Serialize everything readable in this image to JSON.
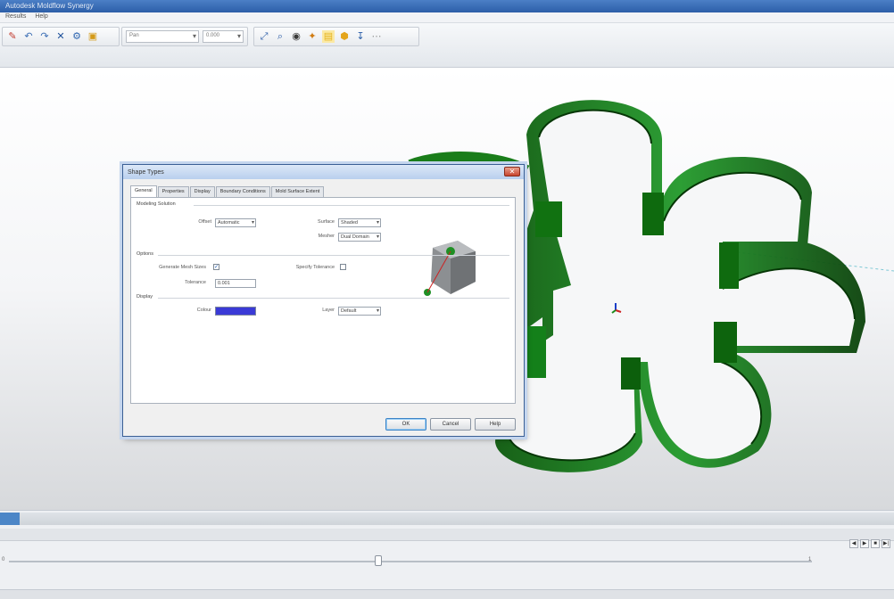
{
  "window": {
    "title": "Autodesk Moldflow Synergy"
  },
  "menu": {
    "items": [
      "Results",
      "Help"
    ]
  },
  "toolbar": {
    "combo1": "Pan",
    "combo2": "0.000",
    "icons": [
      "new-icon",
      "undo-icon",
      "redo-icon",
      "delete-icon",
      "settings-icon",
      "save-icon",
      "rotate-icon",
      "zoom-icon",
      "lock-icon",
      "select-icon",
      "highlight-icon",
      "pin-icon",
      "pointer-icon"
    ]
  },
  "dialog": {
    "title": "Shape Types",
    "tabs": [
      "General",
      "Properties",
      "Display",
      "Boundary Conditions",
      "Mold Surface Extent"
    ],
    "active_tab": 0,
    "sections": {
      "general": "Modeling Solution",
      "options": "Options",
      "display": "Display"
    },
    "fields": {
      "offset_label": "Offset",
      "offset_value": "Automatic",
      "surface_label": "Surface",
      "surface_value": "Shaded",
      "mesher_label": "Mesher",
      "mesher_value": "Dual Domain",
      "auto_sizes_label": "Generate Mesh Sizes",
      "auto_sizes_checked": true,
      "tolerance_label": "Tolerance",
      "tolerance_value": "0.001",
      "specify_label": "Specify Tolerance",
      "specify_checked": false,
      "color_label": "Colour",
      "color_value": "#3a3ad6",
      "layer_label": "Layer",
      "layer_value": "Default"
    },
    "buttons": {
      "ok": "OK",
      "cancel": "Cancel",
      "help": "Help"
    }
  },
  "timeline": {
    "left_label": "0",
    "right_label": "1",
    "controls": [
      "◀",
      "▶",
      "■",
      "▶|"
    ]
  },
  "colors": {
    "part_green": "#1f8a1f",
    "part_dark": "#0b4d0b",
    "dialog_border": "#3a5f95",
    "accent_blue": "#4c86c7"
  }
}
